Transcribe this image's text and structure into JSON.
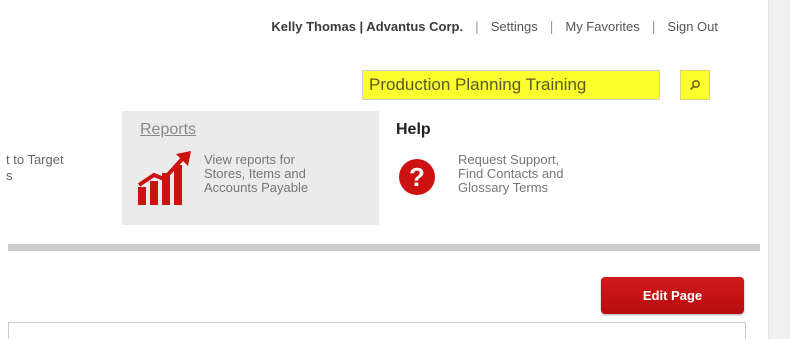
{
  "header": {
    "user_name": "Kelly Thomas | Advantus Corp.",
    "separator": "|",
    "links": [
      {
        "label": "Settings"
      },
      {
        "label": "My Favorites"
      },
      {
        "label": "Sign Out"
      }
    ]
  },
  "search": {
    "value": "Production Planning Training",
    "highlight_color": "#fbff2e",
    "button_icon": "search-icon"
  },
  "menu": {
    "left_partial": {
      "line1": "t to Target",
      "line2": "s"
    },
    "reports": {
      "title": "Reports",
      "description": [
        "View reports for",
        "Stores, Items and",
        "Accounts Payable"
      ],
      "icon": "chart-growth-icon",
      "accent_color": "#cc1111"
    },
    "help": {
      "title": "Help",
      "description": [
        "Request Support,",
        "Find Contacts and",
        "Glossary Terms"
      ],
      "icon": "question-circle-icon",
      "accent_color": "#cc1111"
    }
  },
  "actions": {
    "edit_page_label": "Edit Page",
    "button_color": "#c41212"
  }
}
